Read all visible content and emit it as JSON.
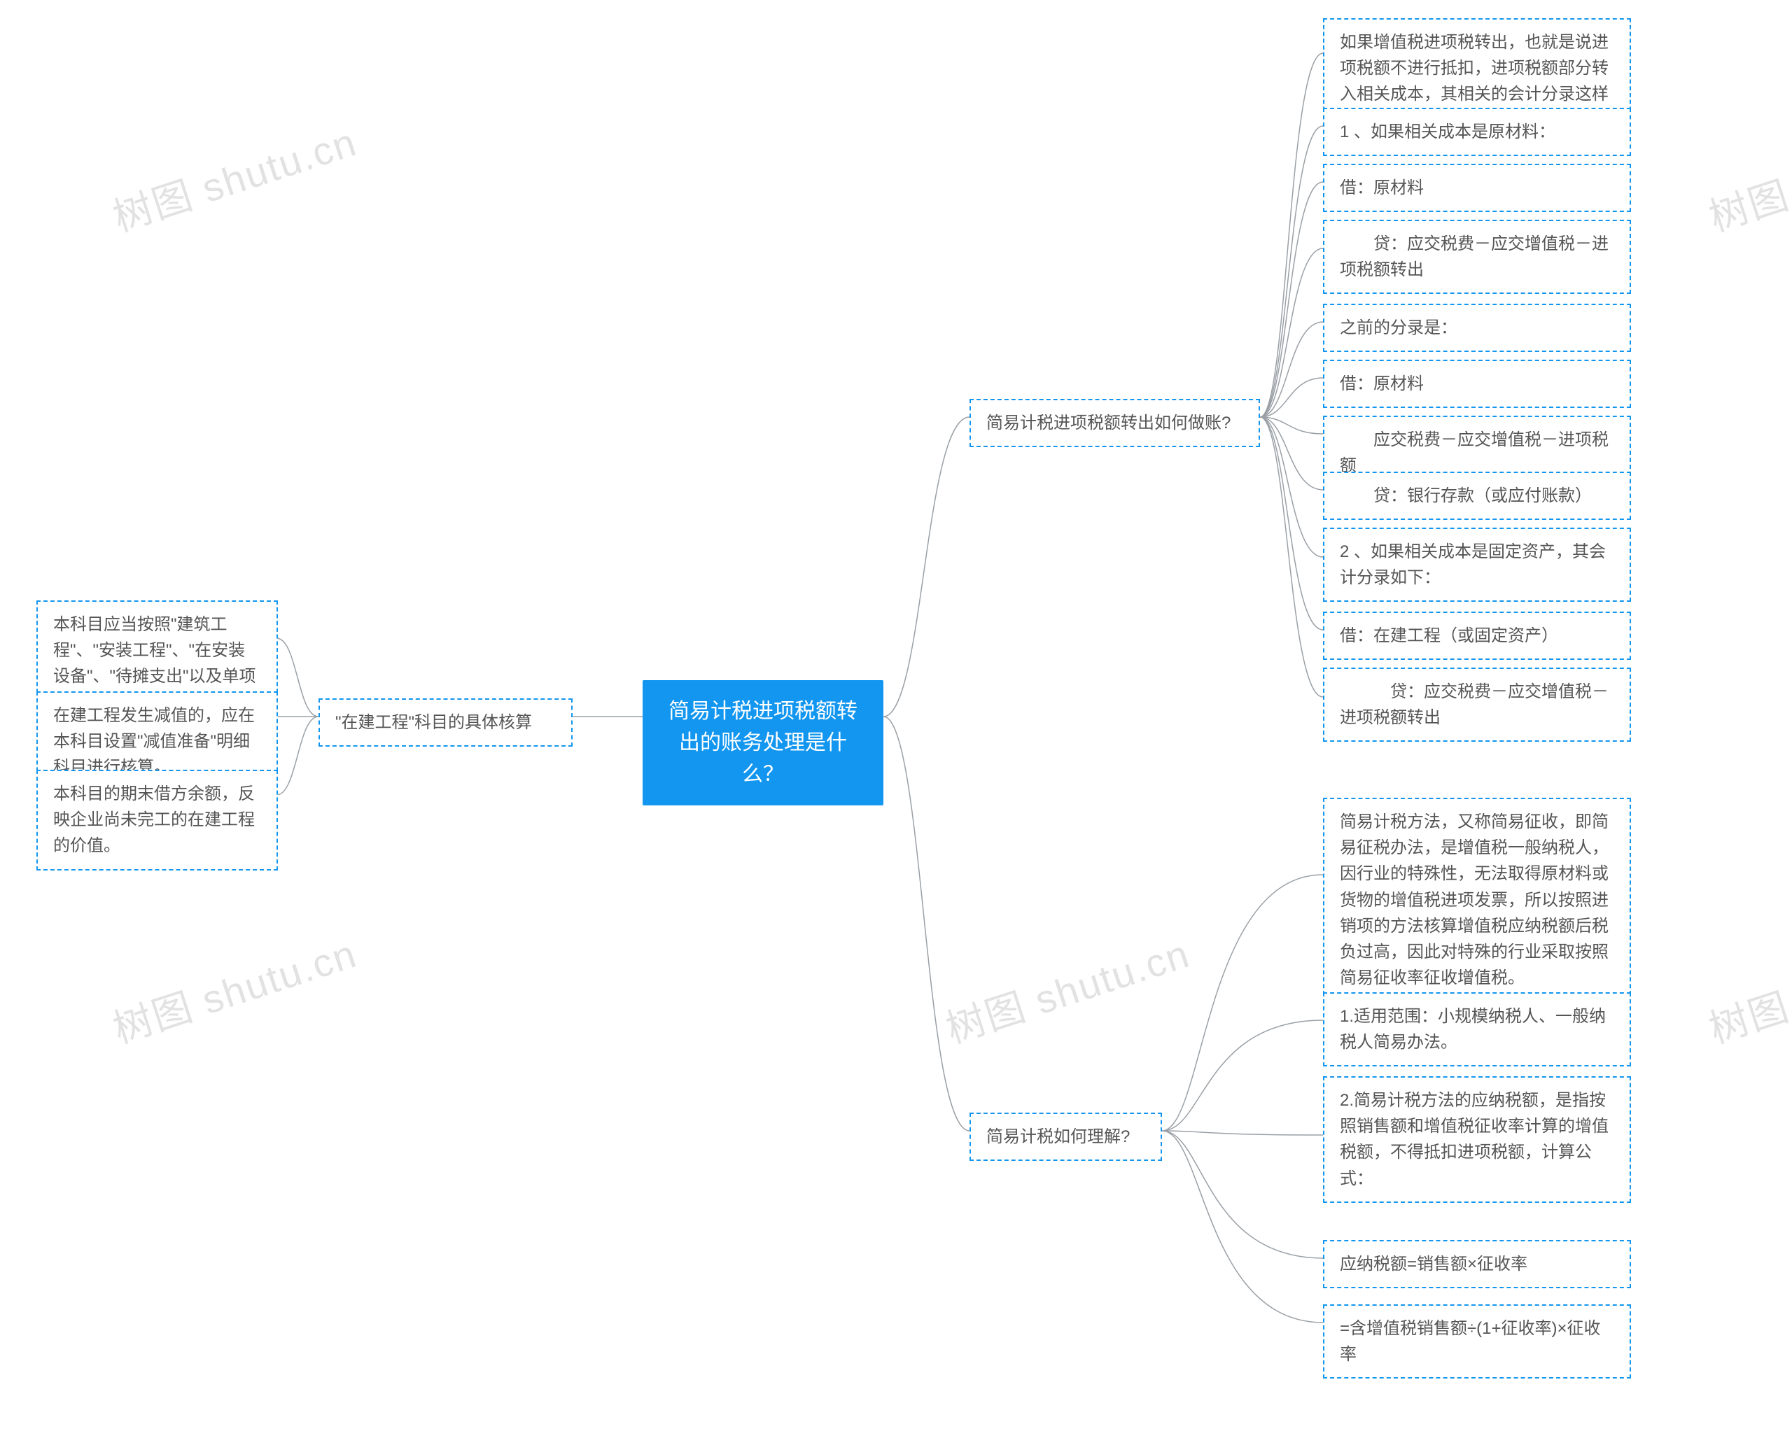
{
  "watermark": "树图 shutu.cn",
  "root": {
    "title": "简易计税进项税额转出的账务处理是什么？"
  },
  "left_branch": {
    "label": "\"在建工程\"科目的具体核算",
    "children": [
      "本科目应当按照\"建筑工程\"、\"安装工程\"、\"在安装设备\"、\"待摊支出\"以及单项工程进行明细核算。",
      "在建工程发生减值的，应在本科目设置\"减值准备\"明细科目进行核算。",
      "本科目的期末借方余额，反映企业尚未完工的在建工程的价值。"
    ]
  },
  "right_branches": [
    {
      "label": "简易计税进项税额转出如何做账?",
      "children": [
        "如果增值税进项税转出，也就是说进项税额不进行抵扣，进项税额部分转入相关成本，其相关的会计分录这样做：",
        "1 、如果相关成本是原材料：",
        "借：原材料",
        "　　贷：应交税费－应交增值税－进项税额转出",
        "之前的分录是：",
        "借：原材料",
        "　　应交税费－应交增值税－进项税额",
        "　　贷：银行存款（或应付账款）",
        "2 、如果相关成本是固定资产，其会计分录如下：",
        "借：在建工程（或固定资产）",
        "　　　贷：应交税费－应交增值税－进项税额转出"
      ]
    },
    {
      "label": "简易计税如何理解?",
      "children": [
        "简易计税方法，又称简易征收，即简易征税办法，是增值税一般纳税人，因行业的特殊性，无法取得原材料或货物的增值税进项发票，所以按照进销项的方法核算增值税应纳税额后税负过高，因此对特殊的行业采取按照简易征收率征收增值税。",
        "1.适用范围：小规模纳税人、一般纳税人简易办法。",
        "2.简易计税方法的应纳税额，是指按照销售额和增值税征收率计算的增值税额，不得抵扣进项税额，计算公式：",
        "应纳税额=销售额×征收率",
        "=含增值税销售额÷(1+征收率)×征收率"
      ]
    }
  ]
}
